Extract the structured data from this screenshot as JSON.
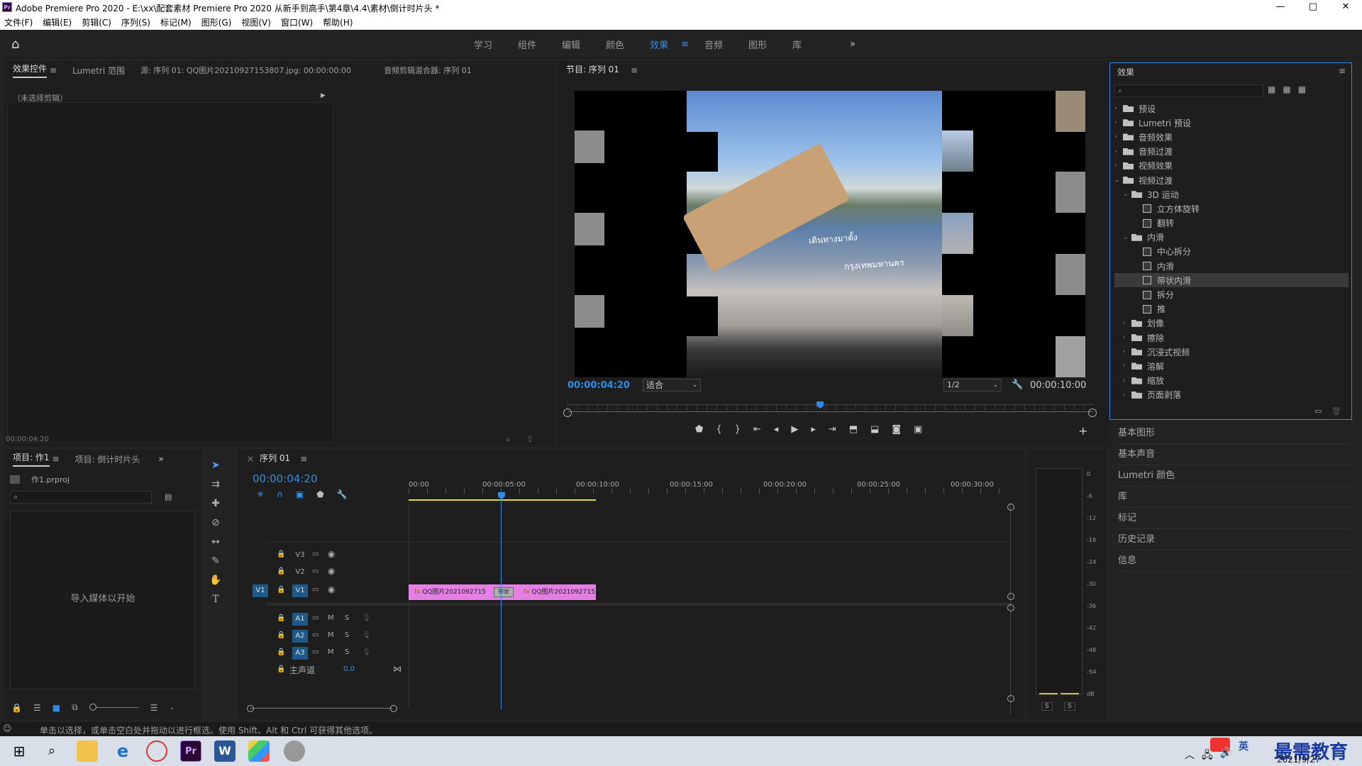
{
  "title_bar": {
    "app_letter": "Pr",
    "title": "Adobe Premiere Pro 2020 - E:\\xx\\配套素材 Premiere Pro 2020 从新手到高手\\第4章\\4.4\\素材\\倒计时片头 *",
    "minimize": "—",
    "maximize": "□",
    "close": "✕"
  },
  "menu": [
    "文件(F)",
    "编辑(E)",
    "剪辑(C)",
    "序列(S)",
    "标记(M)",
    "图形(G)",
    "视图(V)",
    "窗口(W)",
    "帮助(H)"
  ],
  "workspaces": {
    "tabs": [
      "学习",
      "组件",
      "编辑",
      "颜色",
      "效果",
      "音频",
      "图形",
      "库"
    ],
    "active": "效果",
    "more": "»"
  },
  "effect_controls": {
    "tabs": [
      "效果控件",
      "Lumetri 范围",
      "源: 序列 01: QQ图片20210927153807.jpg: 00:00:00:00",
      "音频剪辑混合器: 序列 01"
    ],
    "no_clip": "（未选择剪辑）",
    "timecode": "00:00:04:20"
  },
  "program_monitor": {
    "title": "节目: 序列 01",
    "timecode": "00:00:04:20",
    "fit": "适合",
    "resolution": "1/2",
    "duration": "00:00:10:00",
    "playhead_fraction": 0.48,
    "overlay_text_1": "เดินทางมาตั้ง",
    "overlay_text_2": "กรุงเทพมหานคร"
  },
  "project": {
    "tabs": [
      "项目: 作1",
      "项目: 倒计时片头"
    ],
    "file": "作1.prproj",
    "empty_hint": "导入媒体以开始"
  },
  "timeline": {
    "title": "序列 01",
    "timecode": "00:00:04:20",
    "ruler": [
      "00:00",
      "00:00:05:00",
      "00:00:10:00",
      "00:00:15:00",
      "00:00:20:00",
      "00:00:25:00",
      "00:00:30:00"
    ],
    "tracks": [
      {
        "name": "V3",
        "type": "video"
      },
      {
        "name": "V2",
        "type": "video"
      },
      {
        "name": "V1",
        "type": "video",
        "source": "V1"
      },
      {
        "name": "A1",
        "type": "audio"
      },
      {
        "name": "A2",
        "type": "audio"
      },
      {
        "name": "A3",
        "type": "audio"
      }
    ],
    "master": {
      "label": "主声道",
      "value": "0.0"
    },
    "clips": [
      {
        "label": "QQ图片2021092715",
        "fx": "fx"
      },
      {
        "label": "QQ图片2021092715",
        "fx": "fx"
      }
    ],
    "transition": "带状",
    "mute": "M",
    "solo": "S"
  },
  "meter": {
    "scale": [
      "0",
      "-6",
      "-12",
      "-18",
      "-24",
      "-30",
      "-36",
      "-42",
      "-48",
      "-54",
      "dB"
    ],
    "s_left": "S",
    "s_right": "S"
  },
  "effects_panel": {
    "title": "效果",
    "tree": [
      {
        "label": "预设",
        "level": 0,
        "kind": "folder",
        "open": false
      },
      {
        "label": "Lumetri 预设",
        "level": 0,
        "kind": "folder",
        "open": false
      },
      {
        "label": "音频效果",
        "level": 0,
        "kind": "folder",
        "open": false
      },
      {
        "label": "音频过渡",
        "level": 0,
        "kind": "folder",
        "open": false
      },
      {
        "label": "视频效果",
        "level": 0,
        "kind": "folder",
        "open": false
      },
      {
        "label": "视频过渡",
        "level": 0,
        "kind": "folder",
        "open": true
      },
      {
        "label": "3D 运动",
        "level": 1,
        "kind": "folder",
        "open": true
      },
      {
        "label": "立方体旋转",
        "level": 2,
        "kind": "fx"
      },
      {
        "label": "翻转",
        "level": 2,
        "kind": "fx"
      },
      {
        "label": "内滑",
        "level": 1,
        "kind": "folder",
        "open": true
      },
      {
        "label": "中心拆分",
        "level": 2,
        "kind": "fx"
      },
      {
        "label": "内滑",
        "level": 2,
        "kind": "fx"
      },
      {
        "label": "带状内滑",
        "level": 2,
        "kind": "fx",
        "selected": true
      },
      {
        "label": "拆分",
        "level": 2,
        "kind": "fx"
      },
      {
        "label": "推",
        "level": 2,
        "kind": "fx"
      },
      {
        "label": "划像",
        "level": 1,
        "kind": "folder",
        "open": false
      },
      {
        "label": "擦除",
        "level": 1,
        "kind": "folder",
        "open": false
      },
      {
        "label": "沉浸式视频",
        "level": 1,
        "kind": "folder",
        "open": false
      },
      {
        "label": "溶解",
        "level": 1,
        "kind": "folder",
        "open": false
      },
      {
        "label": "缩放",
        "level": 1,
        "kind": "folder",
        "open": false
      },
      {
        "label": "页面剥落",
        "level": 1,
        "kind": "folder",
        "open": false
      }
    ]
  },
  "side_panels": [
    "基本图形",
    "基本声音",
    "Lumetri 颜色",
    "库",
    "标记",
    "历史记录",
    "信息"
  ],
  "status": "单击以选择，或单击空白处并拖动以进行框选。使用 Shift、Alt 和 Ctrl 可获得其他选项。",
  "taskbar": {
    "date": "2021/9/27",
    "ime": "英",
    "watermark": "最需教育"
  }
}
